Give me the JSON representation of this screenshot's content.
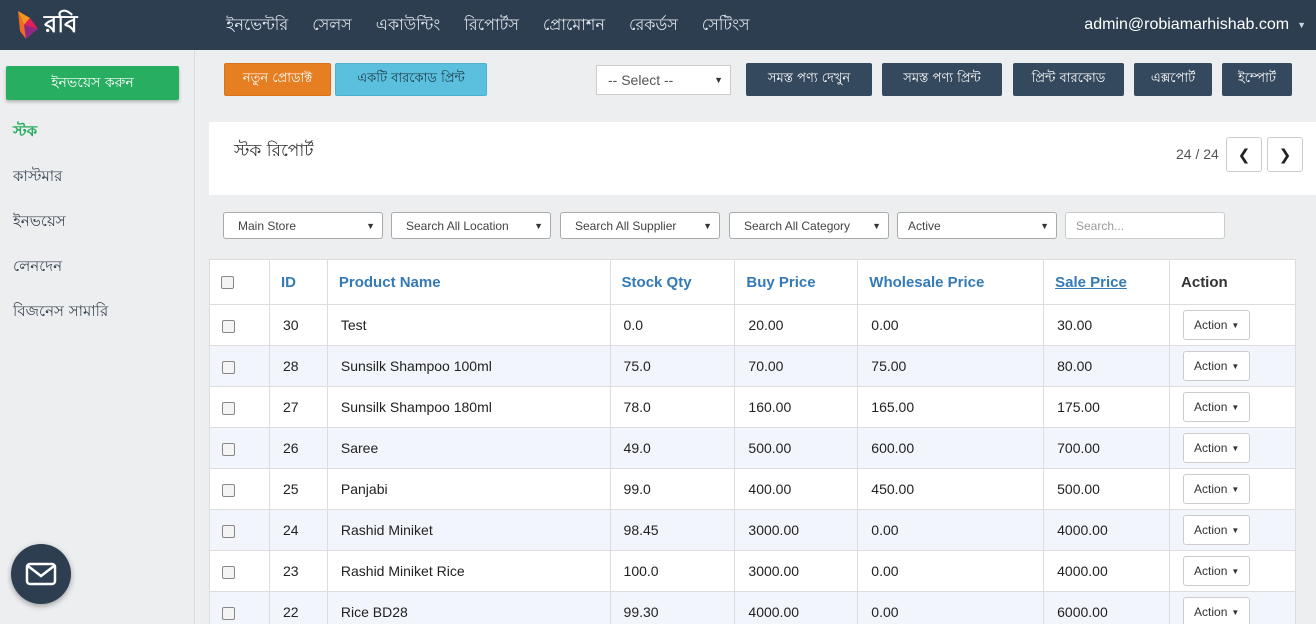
{
  "brand": {
    "name": "রবি"
  },
  "nav": [
    "ইনভেন্টরি",
    "সেলস",
    "একাউন্টিং",
    "রিপোর্টস",
    "প্রোমোশন",
    "রেকর্ডস",
    "সেটিংস"
  ],
  "user": {
    "email": "admin@robiamarhishab.com"
  },
  "sidebar": {
    "invoice_button": "ইনভয়েস করুন",
    "items": [
      "স্টক",
      "কাস্টমার",
      "ইনভয়েস",
      "লেনদেন",
      "বিজনেস সামারি"
    ]
  },
  "toolbar": {
    "new_product": "নতুন প্রোডাক্ট",
    "print_barcode_single": "একটি বারকোড প্রিন্ট",
    "select_placeholder": "-- Select --",
    "view_all": "সমস্ত পণ্য দেখুন",
    "print_all": "সমস্ত পণ্য প্রিন্ট",
    "print_barcode": "প্রিন্ট বারকোড",
    "export": "এক্সপোর্ট",
    "import": "ইম্পোর্ট"
  },
  "panel": {
    "title": "স্টক রিপোর্ট",
    "page_count": "24 / 24"
  },
  "filters": {
    "store": "Main Store",
    "location": "Search All Location",
    "supplier": "Search All Supplier",
    "category": "Search All Category",
    "status": "Active",
    "search_placeholder": "Search..."
  },
  "table": {
    "headers": [
      "ID",
      "Product Name",
      "Stock Qty",
      "Buy Price",
      "Wholesale Price",
      "Sale Price",
      "Action"
    ],
    "action_label": "Action",
    "rows": [
      [
        "30",
        "Test",
        "0.0",
        "20.00",
        "0.00",
        "30.00"
      ],
      [
        "28",
        "Sunsilk Shampoo 100ml",
        "75.0",
        "70.00",
        "75.00",
        "80.00"
      ],
      [
        "27",
        "Sunsilk Shampoo 180ml",
        "78.0",
        "160.00",
        "165.00",
        "175.00"
      ],
      [
        "26",
        "Saree",
        "49.0",
        "500.00",
        "600.00",
        "700.00"
      ],
      [
        "25",
        "Panjabi",
        "99.0",
        "400.00",
        "450.00",
        "500.00"
      ],
      [
        "24",
        "Rashid Miniket",
        "98.45",
        "3000.00",
        "0.00",
        "4000.00"
      ],
      [
        "23",
        "Rashid Miniket Rice",
        "100.0",
        "3000.00",
        "0.00",
        "4000.00"
      ],
      [
        "22",
        "Rice BD28",
        "99.30",
        "4000.00",
        "0.00",
        "6000.00"
      ]
    ]
  }
}
